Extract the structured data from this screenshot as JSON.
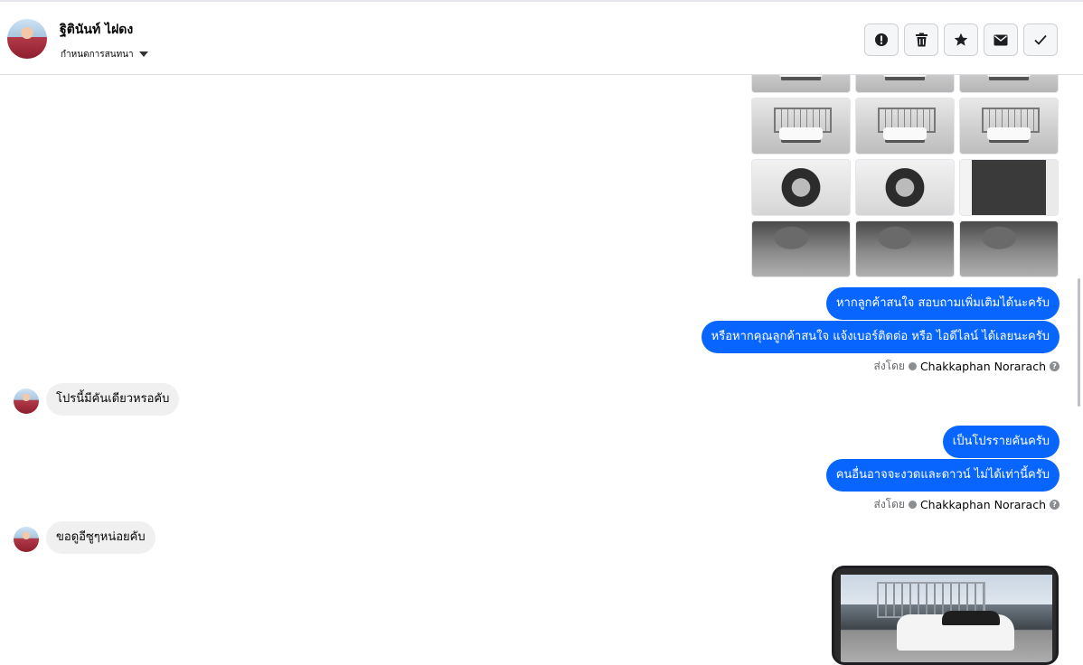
{
  "header": {
    "contact_name": "ฐิตินันท์ ไฝดง",
    "subtitle": "กำหนดการสนทนา",
    "actions": [
      {
        "icon": "alert-icon",
        "name": "report-button"
      },
      {
        "icon": "trash-icon",
        "name": "delete-button"
      },
      {
        "icon": "star-icon",
        "name": "star-button"
      },
      {
        "icon": "mail-icon",
        "name": "mark-unread-button"
      },
      {
        "icon": "check-icon",
        "name": "mark-done-button"
      }
    ]
  },
  "conversation": {
    "outgoing_1": [
      "หากลูกค้าสนใจ สอบถามเพิ่มเติมได้นะครับ",
      "หรือหากคุณลูกค้าสนใจ แจ้งเบอร์ติดต่อ หรือ ไอดีไลน์ ได้เลยนะครับ"
    ],
    "sent_by_label": "ส่งโดย",
    "sender_name": "Chakkaphan Norarach",
    "incoming_1": "โปรนี้มีคันเดียวหรอคับ",
    "outgoing_2": [
      "เป็นโปรรายคันครับ",
      "คนอื่นอาจจะงวดและดาวน์ ไม่ได้เท่านี้ครับ"
    ],
    "incoming_2": "ขอดูอีซูๆหน่อยคับ"
  },
  "colors": {
    "outgoing_bubble": "#0866ff",
    "incoming_bubble": "#f0f0f0"
  }
}
